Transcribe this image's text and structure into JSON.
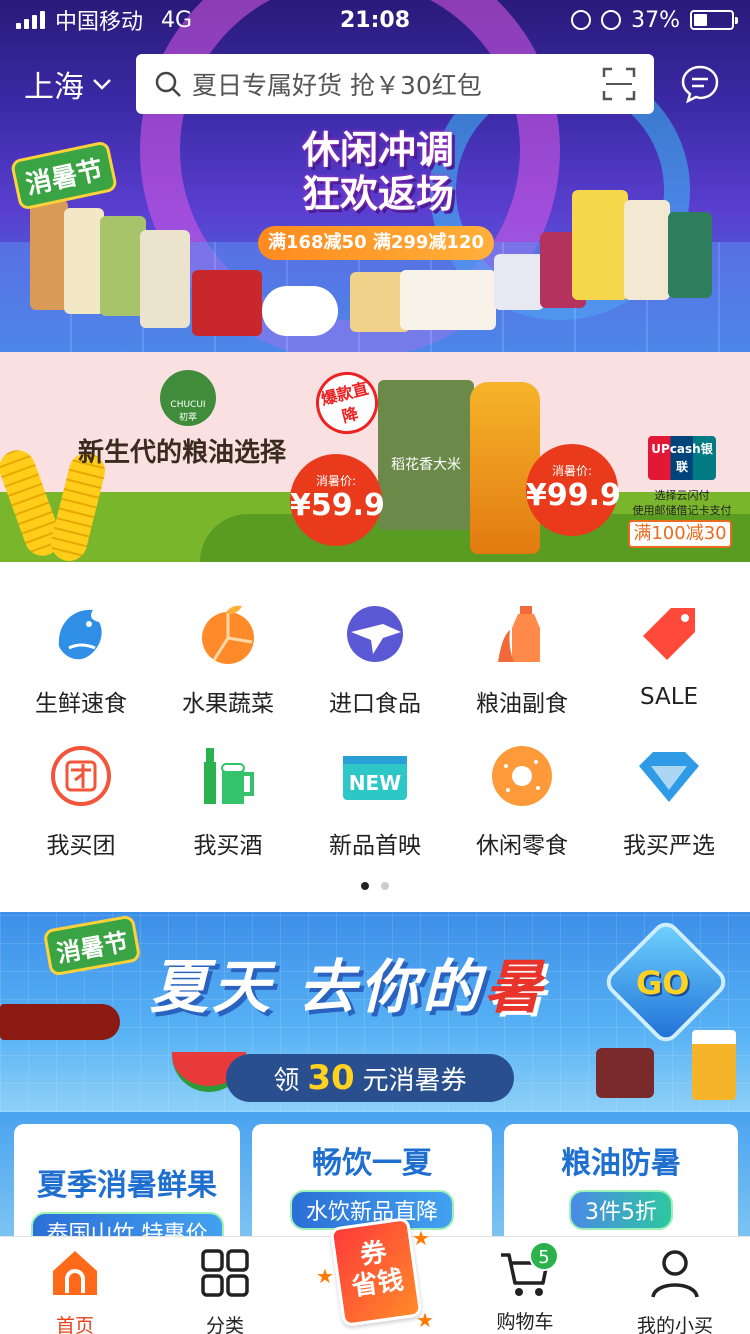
{
  "status": {
    "carrier": "中国移动",
    "network": "4G",
    "time": "21:08",
    "battery": "37%",
    "battery_level": 0.37
  },
  "header": {
    "city": "上海",
    "search_placeholder": "夏日专属好货 抢￥30红包"
  },
  "hero": {
    "badge": "消暑节",
    "title_line1": "休闲冲调",
    "title_line2": "狂欢返场",
    "promo": "满168减50 满299减120"
  },
  "oil_banner": {
    "brand": "CHUCUI",
    "brand_cn": "初萃",
    "headline": "新生代的粮油选择",
    "hot_badge": "爆款直降",
    "price_label": "消暑价:",
    "price1": "¥59.9",
    "price2": "¥99.9",
    "product_rice": "稻花香大米",
    "pay_brand": "UPcash银联",
    "pay_note": "选择云闪付\n使用邮储借记卡支付",
    "coupon": "满100减30"
  },
  "categories": [
    {
      "label": "生鲜速食",
      "icon": "fish-icon"
    },
    {
      "label": "水果蔬菜",
      "icon": "orange-icon"
    },
    {
      "label": "进口食品",
      "icon": "plane-icon"
    },
    {
      "label": "粮油副食",
      "icon": "oil-bottle-icon"
    },
    {
      "label": "SALE",
      "icon": "sale-tag-icon"
    },
    {
      "label": "我买团",
      "icon": "group-icon"
    },
    {
      "label": "我买酒",
      "icon": "wine-beer-icon"
    },
    {
      "label": "新品首映",
      "icon": "new-icon"
    },
    {
      "label": "休闲零食",
      "icon": "donut-icon"
    },
    {
      "label": "我买严选",
      "icon": "diamond-icon"
    }
  ],
  "pager": {
    "current": 1,
    "total": 2
  },
  "summer_banner": {
    "badge": "消暑节",
    "title_part1": "夏天 去你的",
    "title_part2": "暑",
    "go": "GO",
    "coupon_prefix": "领",
    "coupon_amount": "30",
    "coupon_suffix": "元消暑券"
  },
  "cards": [
    {
      "title": "夏季消暑鲜果",
      "subtitle": "泰国山竹 特惠价"
    },
    {
      "title": "畅饮一夏",
      "subtitle": "水饮新品直降"
    },
    {
      "title": "粮油防暑",
      "subtitle": "3件5折"
    }
  ],
  "tabbar": {
    "home": "首页",
    "category": "分类",
    "coupon_top": "券",
    "coupon_bottom": "省钱",
    "cart": "购物车",
    "cart_count": "5",
    "mine": "我的小买"
  },
  "colors": {
    "accent": "#e8421a",
    "brand_blue": "#1e6fd0",
    "cart_badge": "#2bb24c"
  }
}
